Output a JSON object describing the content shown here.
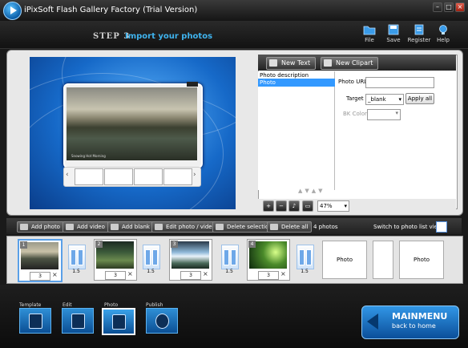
{
  "titlebar": {
    "title": "iPixSoft Flash Gallery Factory (Trial Version)"
  },
  "header": {
    "step_label": "STEP 3",
    "step_text": "Import your photos",
    "buttons": [
      {
        "label": "File",
        "icon": "folder-icon"
      },
      {
        "label": "Save",
        "icon": "save-icon"
      },
      {
        "label": "Register",
        "icon": "register-icon"
      },
      {
        "label": "Help",
        "icon": "lightbulb-icon"
      }
    ]
  },
  "preview": {
    "caption": "Snowing Hot Morning"
  },
  "editor": {
    "new_text_label": "New Text",
    "new_clipart_label": "New Clipart",
    "layers": [
      "Photo description",
      "Photo"
    ],
    "photo_url_label": "Photo URL",
    "photo_url_value": "",
    "target_label": "Target",
    "target_value": "_blank",
    "apply_all_label": "Apply all",
    "bk_color_label": "BK Color",
    "zoom_value": "47%"
  },
  "actions": {
    "add_photo": "Add photo",
    "add_video": "Add video",
    "add_blank": "Add blank",
    "edit_photo_video": "Edit photo / video",
    "delete_selection": "Delete selection",
    "delete_all": "Delete all",
    "photo_count": "4 photos",
    "switch_view": "Switch to photo list view"
  },
  "filmstrip": {
    "cards": [
      {
        "num": "1",
        "duration": "3"
      },
      {
        "num": "2",
        "duration": "3"
      },
      {
        "num": "3",
        "duration": "3"
      },
      {
        "num": "4",
        "duration": "3"
      }
    ],
    "transitions": [
      "1.5",
      "1.5",
      "1.5",
      "1.5",
      "1.5"
    ],
    "placeholders": [
      "Photo",
      "Photo"
    ]
  },
  "steps": [
    "Template",
    "Edit",
    "Photo",
    "Publish"
  ],
  "mainmenu": {
    "title": "MAINMENU",
    "subtitle": "back to home"
  },
  "colors": {
    "accent": "#3fb3ee",
    "selection": "#3399ff"
  }
}
